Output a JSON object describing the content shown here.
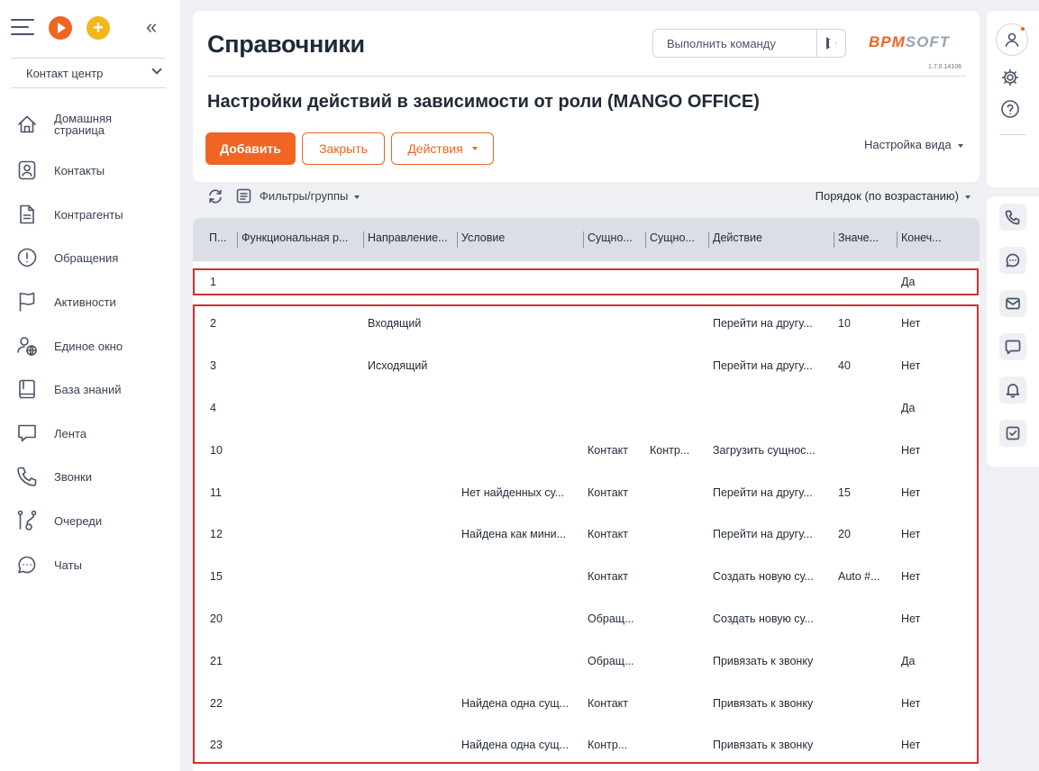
{
  "sidebar": {
    "workplace": "Контакт центр",
    "items": [
      {
        "label": "Домашняя страница",
        "icon": "home-icon"
      },
      {
        "label": "Контакты",
        "icon": "contact-icon"
      },
      {
        "label": "Контрагенты",
        "icon": "document-icon"
      },
      {
        "label": "Обращения",
        "icon": "alert-icon"
      },
      {
        "label": "Активности",
        "icon": "flag-icon"
      },
      {
        "label": "Единое окно",
        "icon": "user-globe-icon"
      },
      {
        "label": "База знаний",
        "icon": "book-icon"
      },
      {
        "label": "Лента",
        "icon": "feed-icon"
      },
      {
        "label": "Звонки",
        "icon": "phone-icon"
      },
      {
        "label": "Очереди",
        "icon": "queue-icon"
      },
      {
        "label": "Чаты",
        "icon": "chat-icon"
      }
    ]
  },
  "header": {
    "title": "Справочники",
    "command_placeholder": "Выполнить команду",
    "logo_main": "BPM",
    "logo_soft": "SOFT",
    "version": "1.7.0.14106"
  },
  "section": {
    "title": "Настройки действий в зависимости от роли (MANGO OFFICE)",
    "add_label": "Добавить",
    "close_label": "Закрыть",
    "actions_label": "Действия",
    "view_settings": "Настройка вида"
  },
  "toolbar": {
    "filters": "Фильтры/группы",
    "sort": "Порядок (по возрастанию)"
  },
  "grid": {
    "columns": [
      "П...",
      "Функциональная р...",
      "Направление...",
      "Условие",
      "Сущно...",
      "Сущно...",
      "Действие",
      "Значе...",
      "Конеч..."
    ],
    "rows": [
      [
        "1",
        "",
        "",
        "",
        "",
        "",
        "",
        "",
        "Да"
      ],
      [
        "2",
        "",
        "Входящий",
        "",
        "",
        "",
        "Перейти на другу...",
        "10",
        "Нет"
      ],
      [
        "3",
        "",
        "Исходящий",
        "",
        "",
        "",
        "Перейти на другу...",
        "40",
        "Нет"
      ],
      [
        "4",
        "",
        "",
        "",
        "",
        "",
        "",
        "",
        "Да"
      ],
      [
        "10",
        "",
        "",
        "",
        "Контакт",
        "Контр...",
        "Загрузить сущнос...",
        "",
        "Нет"
      ],
      [
        "11",
        "",
        "",
        "Нет найденных су...",
        "Контакт",
        "",
        "Перейти на другу...",
        "15",
        "Нет"
      ],
      [
        "12",
        "",
        "",
        "Найдена как мини...",
        "Контакт",
        "",
        "Перейти на другу...",
        "20",
        "Нет"
      ],
      [
        "15",
        "",
        "",
        "",
        "Контакт",
        "",
        "Создать новую су...",
        "Auto #...",
        "Нет"
      ],
      [
        "20",
        "",
        "",
        "",
        "Обращ...",
        "",
        "Создать новую су...",
        "",
        "Нет"
      ],
      [
        "21",
        "",
        "",
        "",
        "Обращ...",
        "",
        "Привязать к звонку",
        "",
        "Да"
      ],
      [
        "22",
        "",
        "",
        "Найдена одна сущ...",
        "Контакт",
        "",
        "Привязать к звонку",
        "",
        "Нет"
      ],
      [
        "23",
        "",
        "",
        "Найдена одна сущ...",
        "Контр...",
        "",
        "Привязать к звонку",
        "",
        "Нет"
      ]
    ]
  },
  "colors": {
    "accent": "#f06424",
    "highlight": "#d32f2f"
  }
}
